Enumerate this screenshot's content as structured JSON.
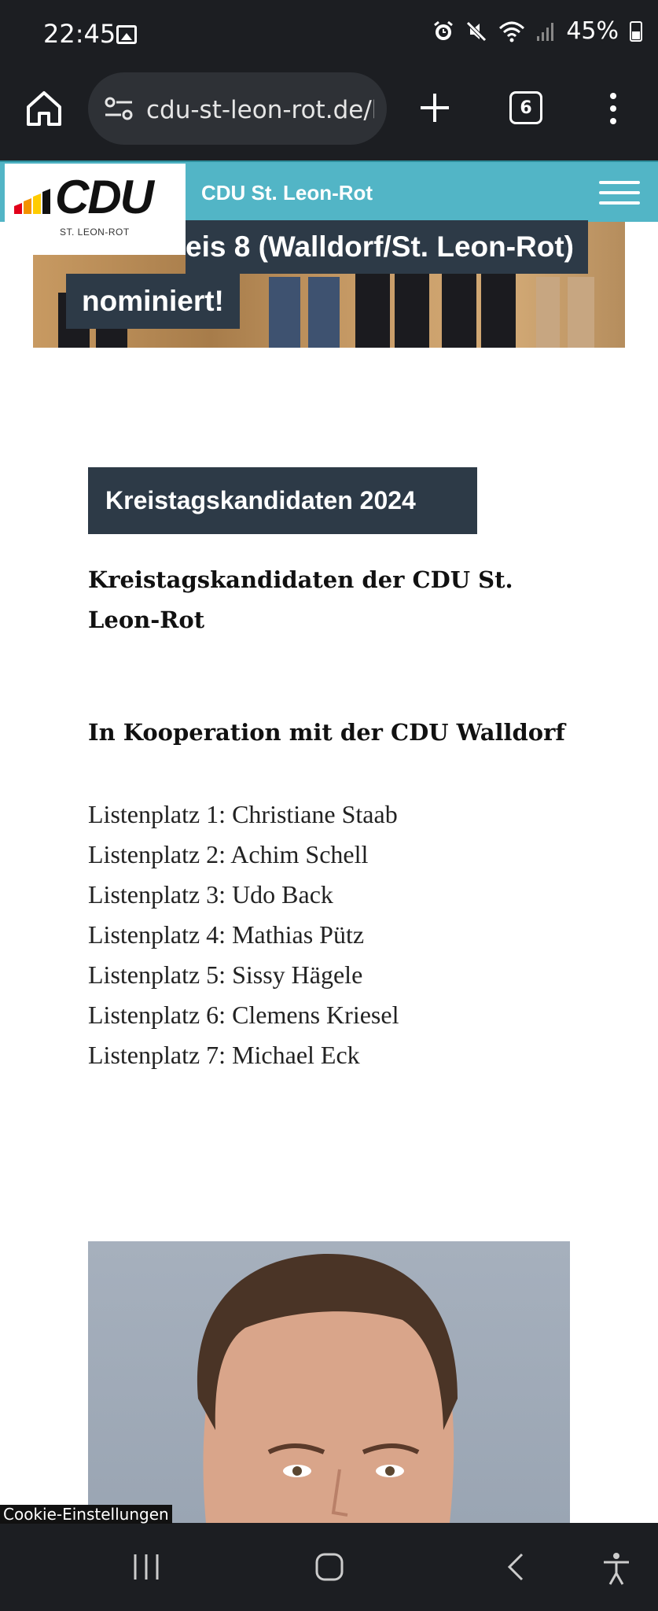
{
  "status_bar": {
    "time": "22:45",
    "battery": "45%",
    "icons": [
      "image-icon",
      "alarm-icon",
      "mute-icon",
      "wifi-icon",
      "signal-icon",
      "battery-icon"
    ]
  },
  "browser": {
    "url": "cdu-st-leon-rot.de/k",
    "tab_count": "6"
  },
  "site": {
    "logo_text": "CDU",
    "logo_subtext": "ST. LEON-ROT",
    "title": "CDU St. Leon-Rot",
    "accent_color": "#52b5c6",
    "dark_color": "#2d3a47"
  },
  "hero": {
    "line1": "eis 8 (Walldorf/St. Leon-Rot)",
    "line2": "nominiert!"
  },
  "content": {
    "section_label": "Kreistagskandidaten 2024",
    "headline": "Kreistagskandidaten der CDU St. Leon-Rot",
    "subheading": "In Kooperation mit der CDU Walldorf",
    "list": [
      "Listenplatz 1: Christiane Staab",
      "Listenplatz 2: Achim Schell",
      "Listenplatz 3: Udo Back",
      "Listenplatz 4: Mathias Pütz",
      "Listenplatz 5: Sissy Hägele",
      "Listenplatz 6: Clemens Kriesel",
      "Listenplatz 7: Michael Eck"
    ]
  },
  "cookie_label": "Cookie-Einstellungen"
}
